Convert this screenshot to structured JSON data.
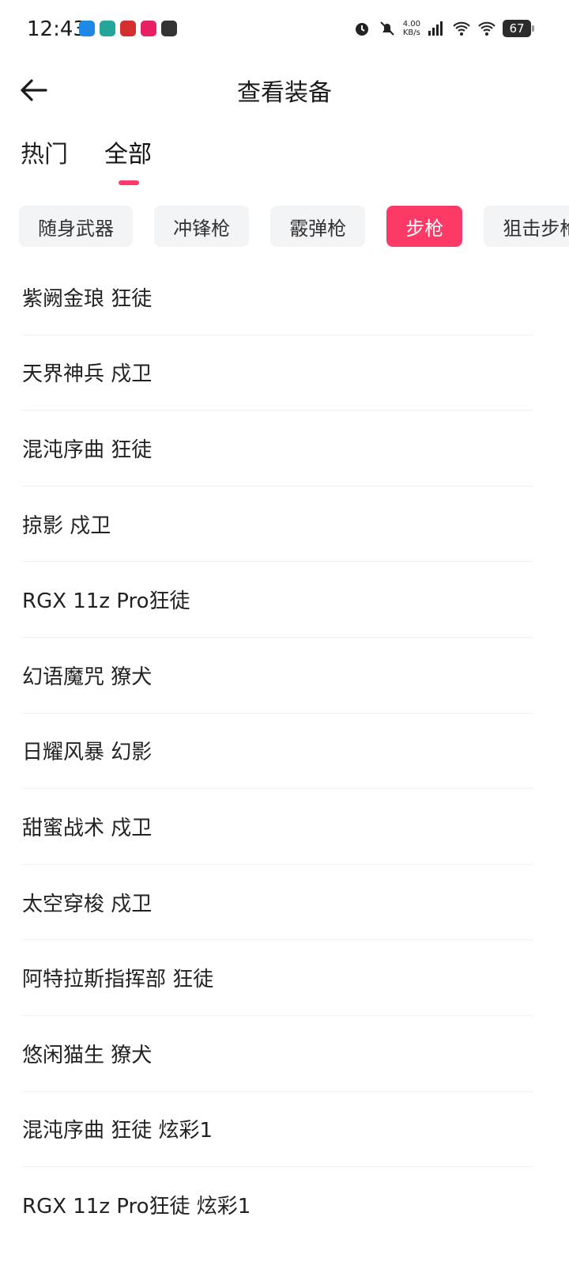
{
  "status_bar": {
    "time": "12:43",
    "net_speed": "4.00",
    "net_unit": "KB/s",
    "network_type": "4G",
    "battery": "67"
  },
  "header": {
    "title": "查看装备"
  },
  "tabs": [
    {
      "label": "热门",
      "active": false
    },
    {
      "label": "全部",
      "active": true
    }
  ],
  "categories": [
    {
      "label": "随身武器",
      "active": false
    },
    {
      "label": "冲锋枪",
      "active": false
    },
    {
      "label": "霰弹枪",
      "active": false
    },
    {
      "label": "步枪",
      "active": true
    },
    {
      "label": "狙击步枪",
      "active": false
    }
  ],
  "items": [
    "紫阙金琅 狂徒",
    "天界神兵 戍卫",
    "混沌序曲 狂徒",
    "掠影 戍卫",
    "RGX 11z Pro狂徒",
    "幻语魔咒 獠犬",
    "日耀风暴 幻影",
    "甜蜜战术 戍卫",
    "太空穿梭 戍卫",
    "阿特拉斯指挥部 狂徒",
    "悠闲猫生 獠犬",
    "混沌序曲 狂徒 炫彩1",
    "RGX 11z Pro狂徒 炫彩1"
  ],
  "colors": {
    "accent": "#fd3a66",
    "chip_bg": "#f2f4f6"
  }
}
